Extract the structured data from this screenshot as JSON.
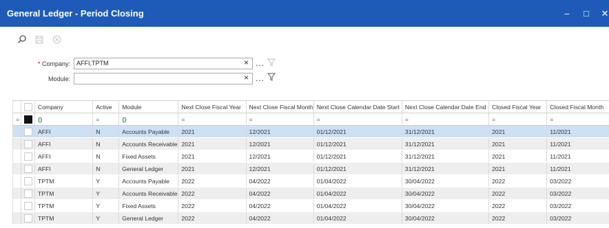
{
  "window": {
    "title": "General Ledger - Period Closing",
    "minimize": "–",
    "maximize": "□",
    "close": "✕"
  },
  "toolbar": {
    "search_icon": "search-icon",
    "save_icon": "save-icon",
    "cancel_icon": "cancel-icon"
  },
  "form": {
    "company_label": "* Company:",
    "company_value": "AFFI,TPTM",
    "module_label": "Module:",
    "module_value": "",
    "clear_symbol": "×",
    "ellipsis": "..."
  },
  "grid": {
    "columns": [
      "Company",
      "Active",
      "Module",
      "Next Close Fiscal Year",
      "Next Close Fiscal Month",
      "Next Close Calendar Date Start",
      "Next Close Calendar Date End",
      "Closed Fiscal Year",
      "Closed Fiscal Month"
    ],
    "filter_eq": "=",
    "filter_icon": "{}",
    "rows": [
      [
        "AFFI",
        "N",
        "Accounts Payable",
        "2021",
        "12/2021",
        "01/12/2021",
        "31/12/2021",
        "2021",
        "11/2021"
      ],
      [
        "AFFI",
        "N",
        "Accounts Receivable",
        "2021",
        "12/2021",
        "01/12/2021",
        "31/12/2021",
        "2021",
        "11/2021"
      ],
      [
        "AFFI",
        "N",
        "Fixed Assets",
        "2021",
        "12/2021",
        "01/12/2021",
        "31/12/2021",
        "2021",
        "11/2021"
      ],
      [
        "AFFI",
        "N",
        "General Ledger",
        "2021",
        "12/2021",
        "01/12/2021",
        "31/12/2021",
        "2021",
        "11/2021"
      ],
      [
        "TPTM",
        "Y",
        "Accounts Payable",
        "2022",
        "04/2022",
        "01/04/2022",
        "30/04/2022",
        "2022",
        "03/2022"
      ],
      [
        "TPTM",
        "Y",
        "Accounts Receivable",
        "2022",
        "04/2022",
        "01/04/2022",
        "30/04/2022",
        "2022",
        "03/2022"
      ],
      [
        "TPTM",
        "Y",
        "Fixed Assets",
        "2022",
        "04/2022",
        "01/04/2022",
        "30/04/2022",
        "2022",
        "03/2022"
      ],
      [
        "TPTM",
        "Y",
        "General Ledger",
        "2022",
        "04/2022",
        "01/04/2022",
        "30/04/2022",
        "2022",
        "03/2022"
      ]
    ]
  },
  "colors": {
    "titlebar": "#1e5bb8",
    "selected_row": "#cde0f4",
    "alt_row": "#eeeeee"
  }
}
